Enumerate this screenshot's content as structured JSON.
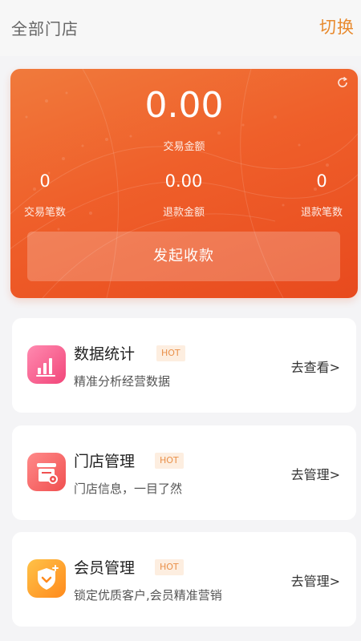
{
  "header": {
    "store_label": "全部门店",
    "switch_label": "切换"
  },
  "summary": {
    "amount": "0.00",
    "amount_label": "交易金额",
    "stats": [
      {
        "value": "0",
        "label": "交易笔数"
      },
      {
        "value": "0.00",
        "label": "退款金额"
      },
      {
        "value": "0",
        "label": "退款笔数"
      }
    ],
    "collect_button": "发起收款"
  },
  "cards": [
    {
      "title": "数据统计",
      "badge": "HOT",
      "desc": "精准分析经营数据",
      "action": "去查看>",
      "icon": "bar-chart-icon"
    },
    {
      "title": "门店管理",
      "badge": "HOT",
      "desc": "门店信息，一目了然",
      "action": "去管理>",
      "icon": "store-icon"
    },
    {
      "title": "会员管理",
      "badge": "HOT",
      "desc": "锁定优质客户,会员精准营销",
      "action": "去管理>",
      "icon": "member-shield-icon"
    }
  ],
  "colors": {
    "accent": "#e88a2e",
    "hero_start": "#f07a3c",
    "hero_end": "#e84a1e",
    "badge_bg": "#fdeee0",
    "badge_text": "#e9904a"
  }
}
